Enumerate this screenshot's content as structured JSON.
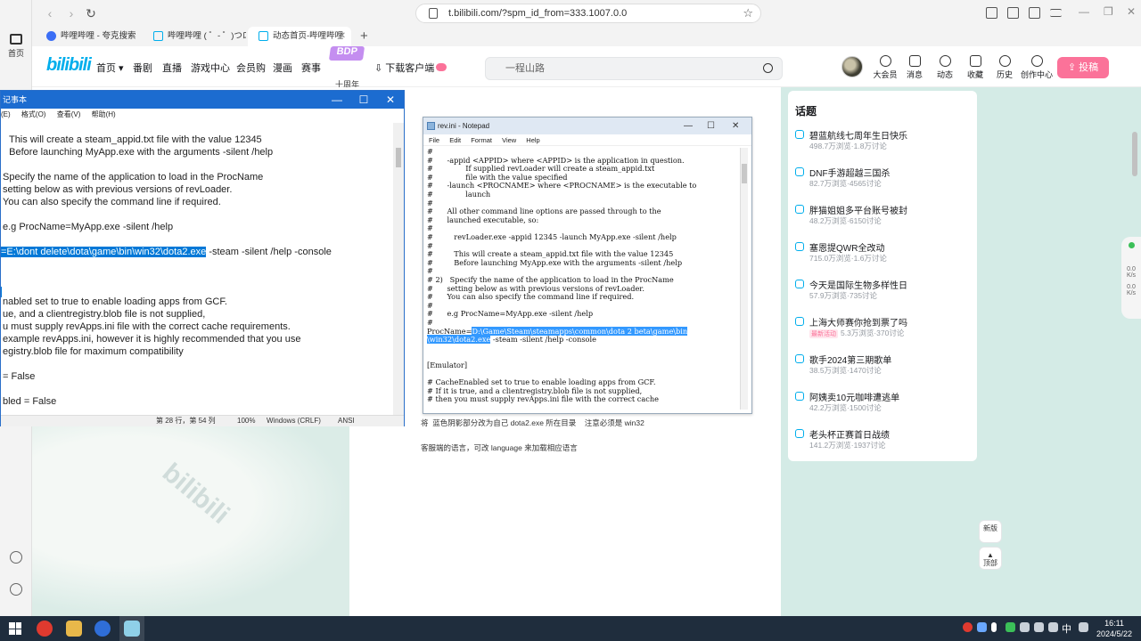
{
  "browser": {
    "home_label": "首页",
    "url": "t.bilibili.com/?spm_id_from=333.1007.0.0",
    "tabs": [
      {
        "label": "哔哩哔哩 - 夸克搜索",
        "color": "#3b6ef5"
      },
      {
        "label": "哔哩哔哩 ( ゜- ゜)つロ 干",
        "color": "#00aeec"
      },
      {
        "label": "动态首页-哔哩哔哩",
        "color": "#00aeec",
        "active": true
      }
    ]
  },
  "bili": {
    "logo": "bilibili",
    "nav": [
      "首页 ▾",
      "番剧",
      "直播",
      "游戏中心",
      "会员购",
      "漫画",
      "赛事"
    ],
    "bdp_badge": "BDP",
    "bdp_sub": "十周年",
    "download": "下载客户端",
    "search_placeholder": "一程山路",
    "right_icons": [
      {
        "label": "大会员",
        "icon": "vip-icon"
      },
      {
        "label": "消息",
        "icon": "message-icon"
      },
      {
        "label": "动态",
        "icon": "dynamic-icon"
      },
      {
        "label": "收藏",
        "icon": "star-icon"
      },
      {
        "label": "历史",
        "icon": "clock-icon"
      },
      {
        "label": "创作中心",
        "icon": "bulb-icon"
      }
    ],
    "upload": "⇪ 投稿",
    "bg_watermark": "bilibili"
  },
  "notepad_cn": {
    "title": "记事本",
    "menu": [
      "(E)",
      "格式(O)",
      "查看(V)",
      "帮助(H)"
    ],
    "lines": [
      "   This will create a steam_appid.txt file with the value 12345",
      "   Before launching MyApp.exe with the arguments -silent /help",
      "",
      "Specify the name of the application to load in the ProcName",
      "setting below as with previous versions of revLoader.",
      "You can also specify the command line if required.",
      "",
      "e.g ProcName=MyApp.exe -silent /help",
      "",
      "",
      "",
      "",
      "",
      "nabled set to true to enable loading apps from GCF.",
      "ue, and a clientregistry.blob file is not supplied,",
      "u must supply revApps.ini file with the correct cache requirements.",
      "example revApps.ini, however it is highly recommended that you use",
      "egistry.blob file for maximum compatibility",
      "",
      "= False",
      "",
      "bled = False"
    ],
    "selected_line": "=E:\\dont delete\\dota\\game\\bin\\win32\\dota2.exe",
    "selected_rest": " -steam -silent /help -console",
    "status": {
      "position": "第 28 行，第 54 列",
      "zoom": "100%",
      "eol": "Windows (CRLF)",
      "encoding": "ANSI"
    }
  },
  "notepad_en": {
    "title": "rev.ini - Notepad",
    "menu": [
      "File",
      "Edit",
      "Format",
      "View",
      "Help"
    ],
    "lines": [
      "#",
      "#      -appid <APPID> where <APPID> is the application in question.",
      "#              If supplied revLoader will create a steam_appid.txt",
      "#              file with the value specified",
      "#      -launch <PROCNAME> where <PROCNAME> is the executable to",
      "#              launch",
      "#",
      "#      All other command line options are passed through to the",
      "#      launched executable, so:",
      "#",
      "#         revLoader.exe -appid 12345 -launch MyApp.exe -silent /help",
      "#",
      "#         This will create a steam_appid.txt file with the value 12345",
      "#         Before launching MyApp.exe with the arguments -silent /help",
      "#",
      "# 2)   Specify the name of the application to load in the ProcName",
      "#      setting below as with previous versions of revLoader.",
      "#      You can also specify the command line if required.",
      "#",
      "#      e.g ProcName=MyApp.exe -silent /help",
      "#"
    ],
    "proc_prefix": "ProcName=",
    "proc_sel_1": "D:\\Game\\Steam\\steamapps\\common\\dota 2 beta\\game\\bin",
    "proc_sel_2": "\\win32\\dota2.exe",
    "proc_rest": " -steam -silent /help -console",
    "tail_lines": [
      "",
      "",
      "[Emulator]",
      "",
      "# CacheEnabled set to true to enable loading apps from GCF.",
      "# If it is true, and a clientregistry.blob file is not supplied,",
      "# then you must supply revApps.ini file with the correct cache"
    ]
  },
  "captions": {
    "line1": "将  蓝色阴影部分改为自己 dota2.exe 所在目录    注意必须是 win32",
    "line2": "客服端的语言，可改 language 来加载相应语言"
  },
  "topics": {
    "heading": "话题",
    "items": [
      {
        "name": "碧蓝航线七周年生日快乐",
        "meta": "498.7万浏览·1.8万讨论"
      },
      {
        "name": "DNF手游超越三国杀",
        "meta": "82.7万浏览·4565讨论"
      },
      {
        "name": "胖猫姐姐多平台账号被封",
        "meta": "48.2万浏览·6150讨论"
      },
      {
        "name": "塞恩提QWR全改动",
        "meta": "715.0万浏览·1.6万讨论"
      },
      {
        "name": "今天是国际生物多样性日",
        "meta": "57.9万浏览·735讨论"
      },
      {
        "name": "上海大师赛你抢到票了吗",
        "meta": "5.3万浏览·370讨论",
        "tag": "最新活动"
      },
      {
        "name": "歌手2024第三期歌单",
        "meta": "38.5万浏览·1470讨论"
      },
      {
        "name": "阿姨卖10元咖啡遭逃单",
        "meta": "42.2万浏览·1500讨论"
      },
      {
        "name": "老头杯正赛首日战绩",
        "meta": "141.2万浏览·1937讨论"
      }
    ]
  },
  "float": {
    "new_version": "新版",
    "top": "顶部"
  },
  "side_numbers": [
    "0.0",
    "K/s",
    "0.0",
    "K/s"
  ],
  "clock": {
    "time": "16:11",
    "date": "2024/5/22"
  },
  "tray_lang": "中"
}
